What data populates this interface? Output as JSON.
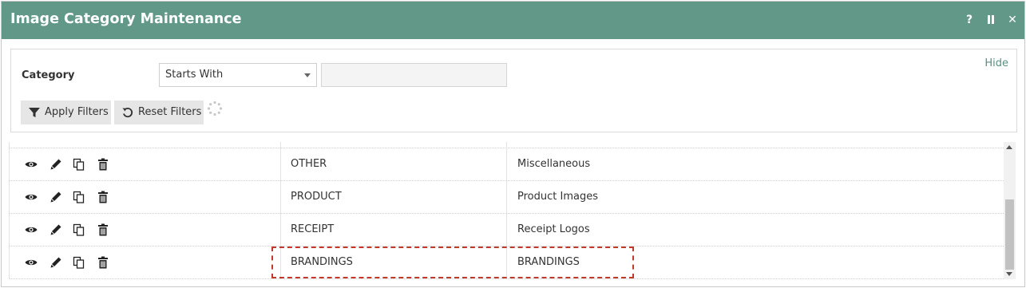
{
  "window": {
    "title": "Image Category Maintenance",
    "help_label": "?",
    "close_label": "✕"
  },
  "filters": {
    "hide_label": "Hide",
    "category_label": "Category",
    "operator_selected": "Starts With",
    "value": "",
    "apply_label": "Apply Filters",
    "reset_label": "Reset Filters"
  },
  "grid": {
    "rows": [
      {
        "code": "OTHER",
        "description": "Miscellaneous"
      },
      {
        "code": "PRODUCT",
        "description": "Product Images"
      },
      {
        "code": "RECEIPT",
        "description": "Receipt Logos"
      },
      {
        "code": "BRANDINGS",
        "description": "BRANDINGS",
        "highlighted": true
      }
    ]
  },
  "colors": {
    "titlebar": "#629887",
    "highlight": "#c0392b"
  }
}
